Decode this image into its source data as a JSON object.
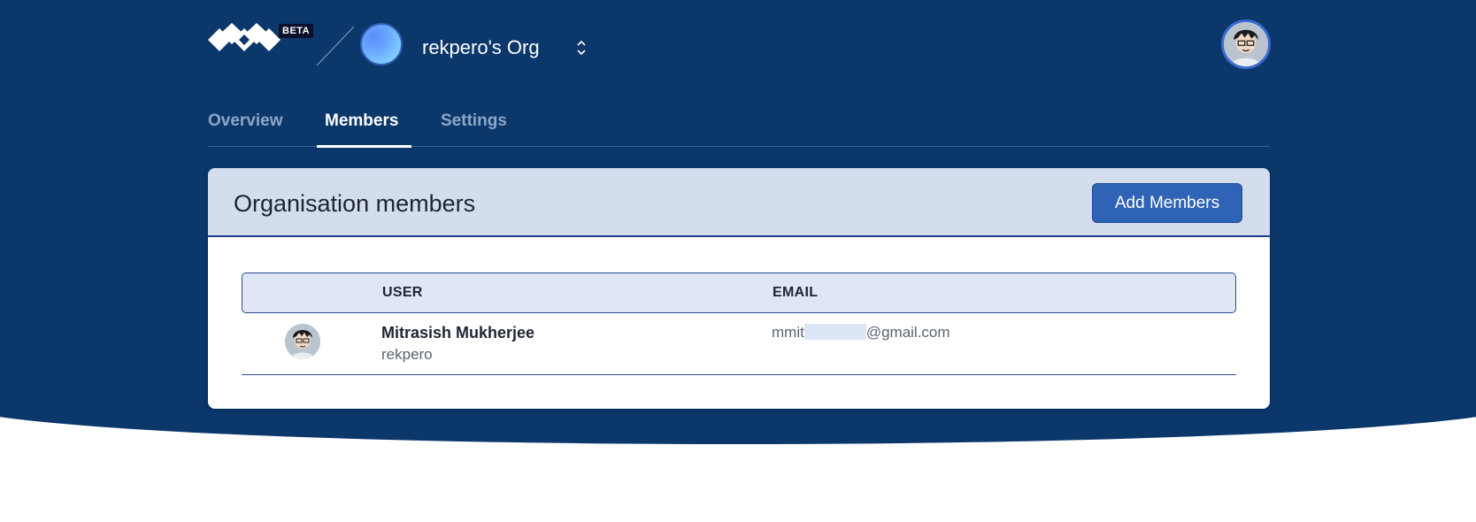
{
  "header": {
    "beta_badge": "BETA",
    "org_name": "rekpero's Org",
    "org_switch_icon": "chevron-up-down-icon",
    "logo_icon": "diamond-logo-icon"
  },
  "tabs": [
    {
      "label": "Overview",
      "active": false
    },
    {
      "label": "Members",
      "active": true
    },
    {
      "label": "Settings",
      "active": false
    }
  ],
  "card": {
    "title": "Organisation members",
    "add_button": "Add Members"
  },
  "table": {
    "columns": [
      "USER",
      "EMAIL"
    ],
    "rows": [
      {
        "name": "Mitrasish Mukherjee",
        "username": "rekpero",
        "email_prefix": "mmit",
        "email_suffix": "@gmail.com"
      }
    ]
  },
  "colors": {
    "hero_bg": "#0b376b",
    "card_header_bg": "#d4ddee",
    "button_bg": "#2f63b5",
    "table_header_bg": "#dfe7f6"
  }
}
